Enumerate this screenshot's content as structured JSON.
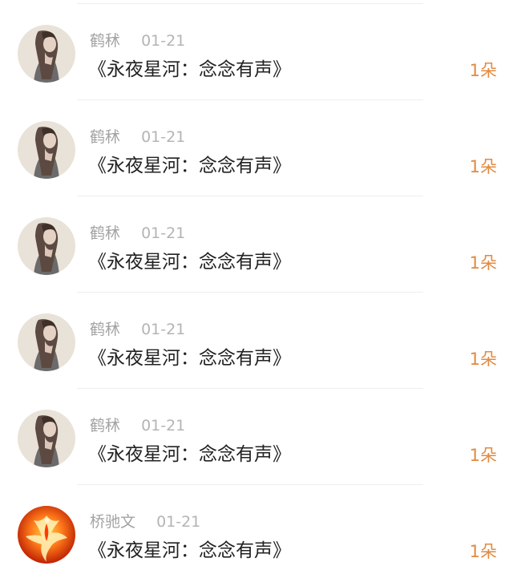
{
  "colors": {
    "accent": "#e28a3f",
    "name_text": "#a3a3a3",
    "date_text": "#b4b4b4",
    "title_text": "#222222",
    "divider": "#efefef"
  },
  "list": {
    "items": [
      {
        "name": "鹤秫",
        "date": "01-21",
        "title": "《永夜星河：念念有声》",
        "amount": "1朵",
        "avatar_icon": "girl-portrait-avatar"
      },
      {
        "name": "鹤秫",
        "date": "01-21",
        "title": "《永夜星河：念念有声》",
        "amount": "1朵",
        "avatar_icon": "girl-portrait-avatar"
      },
      {
        "name": "鹤秫",
        "date": "01-21",
        "title": "《永夜星河：念念有声》",
        "amount": "1朵",
        "avatar_icon": "girl-portrait-avatar"
      },
      {
        "name": "鹤秫",
        "date": "01-21",
        "title": "《永夜星河：念念有声》",
        "amount": "1朵",
        "avatar_icon": "girl-portrait-avatar"
      },
      {
        "name": "鹤秫",
        "date": "01-21",
        "title": "《永夜星河：念念有声》",
        "amount": "1朵",
        "avatar_icon": "girl-portrait-avatar"
      },
      {
        "name": "桥驰文",
        "date": "01-21",
        "title": "《永夜星河：念念有声》",
        "amount": "1朵",
        "avatar_icon": "phoenix-avatar"
      }
    ]
  }
}
